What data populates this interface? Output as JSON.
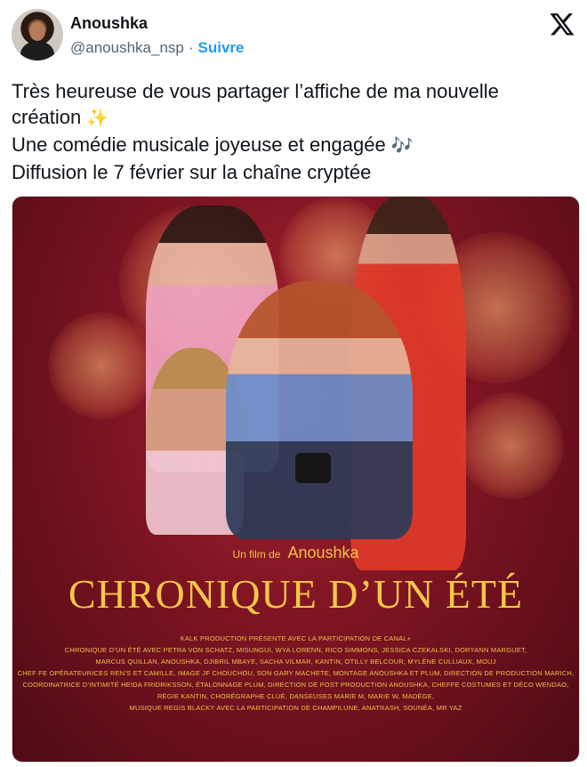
{
  "author": {
    "name": "Anoushka",
    "handle": "@anoushka_nsp",
    "separator": "·",
    "follow_label": "Suivre"
  },
  "icons": {
    "logo": "x-logo-icon",
    "sparkles": "sparkles-emoji",
    "music": "musical-notes-emoji"
  },
  "tweet": {
    "line1": "Très heureuse de vous partager l’affiche de ma nouvelle",
    "line2": "création ",
    "emoji2": "✨",
    "line3": "Une comédie musicale joyeuse et engagée ",
    "emoji3": "🎶",
    "line4": "Diffusion le 7 février sur la chaîne cryptée"
  },
  "poster": {
    "film_prefix": "Un film de",
    "director": "Anoushka",
    "title": "CHRONIQUE D’UN ÉTÉ",
    "credits": [
      "KALK PRODUCTION PRÉSENTE AVEC LA PARTICIPATION DE CANAL+",
      "CHRONIQUE D’UN ÉTÉ AVEC PETRA VON SCHATZ, MISUNGUI, WYA LORENN, RICO SIMMONS, JESSICA CZEKALSKI, DORYANN MARGUET,",
      "MARCUS QUILLAN, ANOUSHKA, DJIBRIL MBAYE, SACHA VILMAR, KANTIN, OTILLY BELCOUR, MYLÈNE CULLIAUX, MOUJ",
      "CHEF FE OPÉRATEURICES REN’S ET CAMILLE, IMAGE JF CHOUCHOU, SON GARY MACHETE, MONTAGE ANOUSHKA ET PLUM, DIRECTION DE PRODUCTION MARICH,",
      "COORDINATRICE D’INTIMITÉ HEIDA FRIDRIKSSON, ÉTALONNAGE PLUM, DIRECTION DE POST PRODUCTION ANOUSHKA, CHEFFE COSTUMES ET DÉCO WENDAO,",
      "RÉGIE KANTIN, CHORÉGRAPHE CLUÉ, DANSEUSES MARIE M, MARIE W, MADÈGE,",
      "MUSIQUE REGIS BLACKY AVEC LA PARTICIPATION DE CHAMPILUNE, ANATRASH, SOUNÉA, MR YAZ"
    ]
  },
  "colors": {
    "accent": "#1d9bf0",
    "text": "#0f1419",
    "muted": "#536471",
    "poster_gold": "#f7c648",
    "poster_red": "#7d1422"
  }
}
